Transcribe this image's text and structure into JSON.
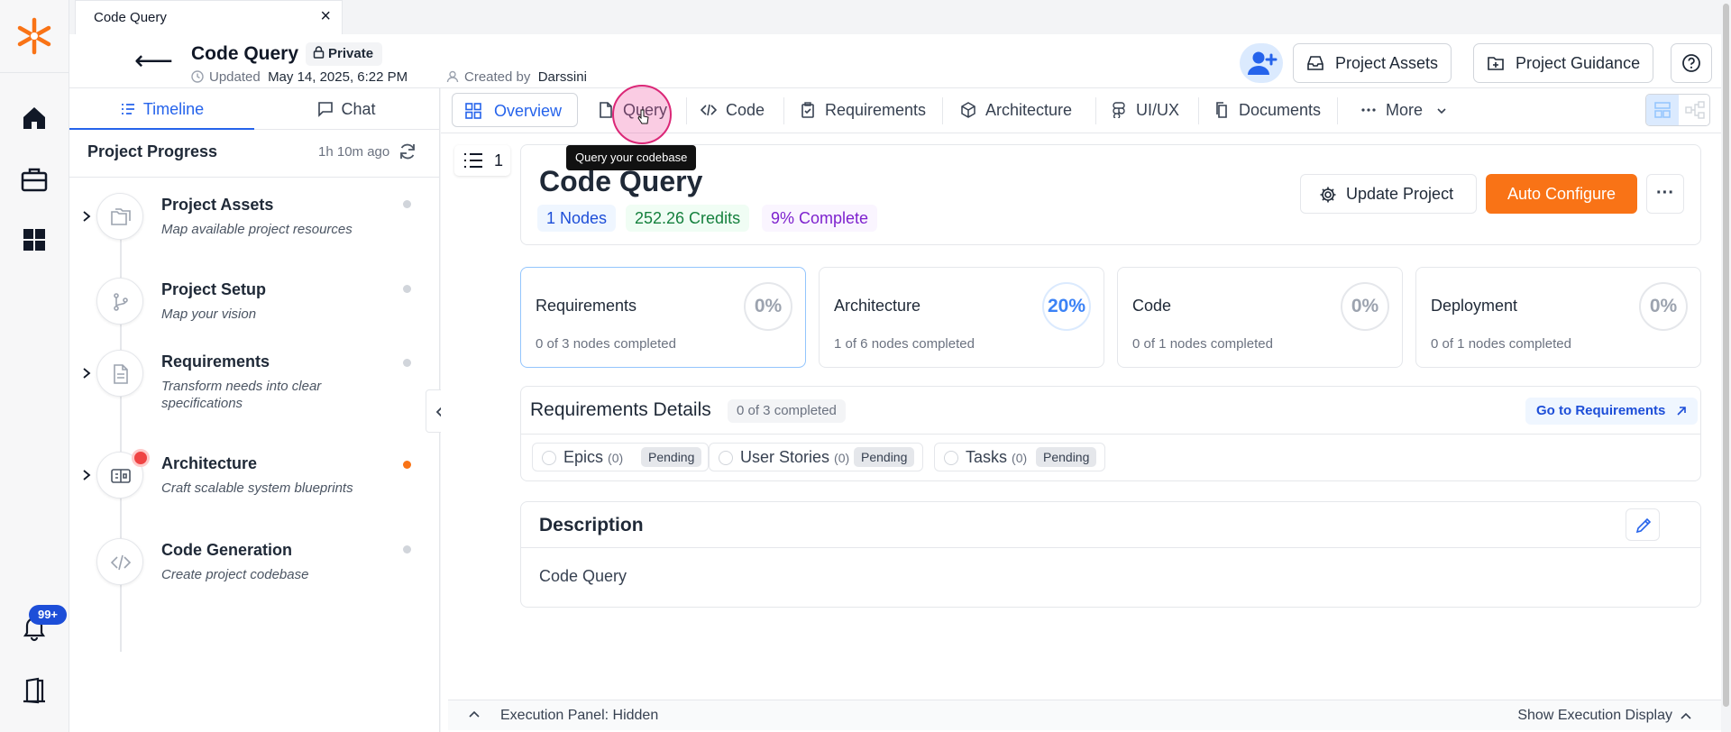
{
  "window_tab": {
    "title": "Code Query"
  },
  "header": {
    "project_name": "Code Query",
    "visibility": "Private",
    "updated_label": "Updated",
    "updated_value": "May 14, 2025, 6:22 PM",
    "created_label": "Created by",
    "created_value": "Darssini",
    "project_assets": "Project Assets",
    "project_guidance": "Project Guidance"
  },
  "rail": {
    "notifications_badge": "99+"
  },
  "left_panel": {
    "tabs": [
      {
        "label": "Timeline"
      },
      {
        "label": "Chat"
      }
    ],
    "progress_title": "Project Progress",
    "progress_ago": "1h 10m ago",
    "steps": [
      {
        "title": "Project Assets",
        "desc": "Map available project resources"
      },
      {
        "title": "Project Setup",
        "desc": "Map your vision"
      },
      {
        "title": "Requirements",
        "desc": "Transform needs into clear specifications"
      },
      {
        "title": "Architecture",
        "desc": "Craft scalable system blueprints"
      },
      {
        "title": "Code Generation",
        "desc": "Create project codebase"
      }
    ]
  },
  "nav_tabs": [
    {
      "label": "Overview"
    },
    {
      "label": "Query"
    },
    {
      "label": "Code"
    },
    {
      "label": "Requirements"
    },
    {
      "label": "Architecture"
    },
    {
      "label": "UI/UX"
    },
    {
      "label": "Documents"
    },
    {
      "label": "More"
    }
  ],
  "tooltip": "Query your codebase",
  "list_count": "1",
  "overview": {
    "title": "Code Query",
    "nodes": "1 Nodes",
    "credits": "252.26 Credits",
    "complete": "9% Complete",
    "update_project": "Update Project",
    "auto_configure": "Auto Configure"
  },
  "stats": [
    {
      "label": "Requirements",
      "percent": "0%",
      "sub": "0 of 3 nodes completed"
    },
    {
      "label": "Architecture",
      "percent": "20%",
      "sub": "1 of 6 nodes completed"
    },
    {
      "label": "Code",
      "percent": "0%",
      "sub": "0 of 1 nodes completed"
    },
    {
      "label": "Deployment",
      "percent": "0%",
      "sub": "0 of 1 nodes completed"
    }
  ],
  "req_details": {
    "title": "Requirements Details",
    "count": "0 of 3 completed",
    "go": "Go to Requirements",
    "chips": [
      {
        "name": "Epics",
        "count": "(0)",
        "status": "Pending"
      },
      {
        "name": "User Stories",
        "count": "(0)",
        "status": "Pending"
      },
      {
        "name": "Tasks",
        "count": "(0)",
        "status": "Pending"
      }
    ]
  },
  "description": {
    "title": "Description",
    "body": "Code Query"
  },
  "execution": {
    "status": "Execution Panel: Hidden",
    "toggle": "Show Execution Display"
  },
  "colors": {
    "accent": "#2563eb",
    "brand": "#f97316"
  }
}
